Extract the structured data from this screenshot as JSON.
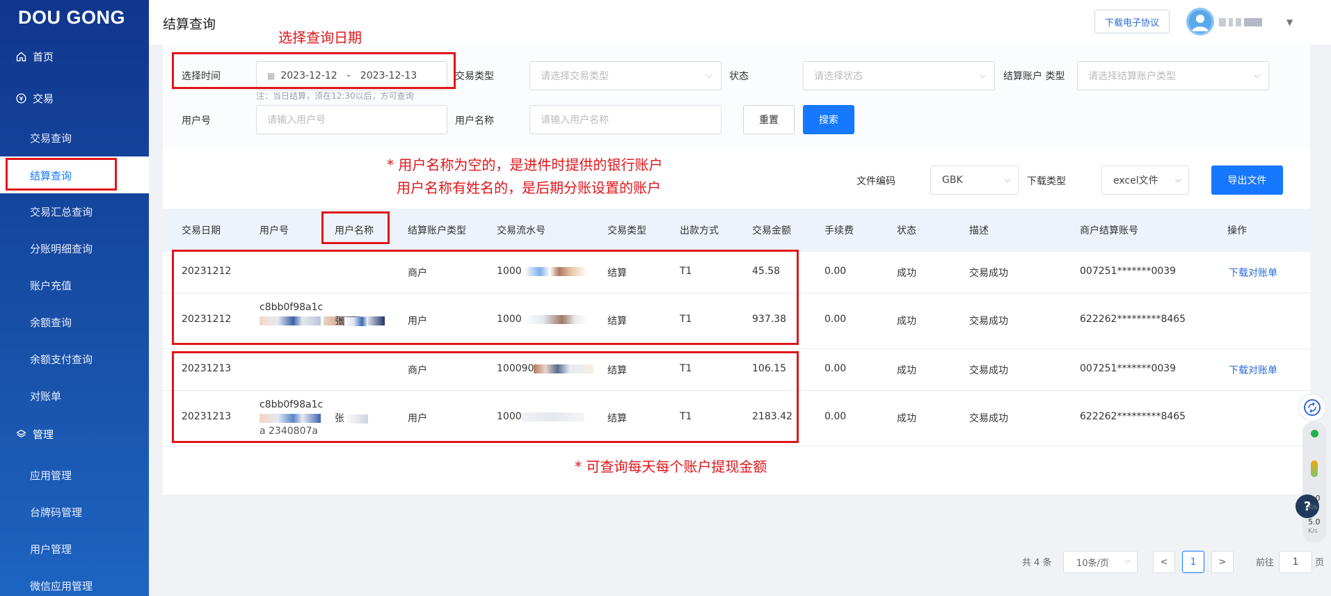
{
  "app": {
    "logo_text": "OU GONG",
    "logo_letter": "D"
  },
  "sidebar": {
    "home": "首页",
    "trade": "交易",
    "items": [
      "交易查询",
      "结算查询",
      "交易汇总查询",
      "分账明细查询",
      "账户充值",
      "余额查询",
      "余额支付查询",
      "对账单"
    ],
    "manage": "管理",
    "manage_items": [
      "应用管理",
      "台牌码管理",
      "用户管理",
      "微信应用管理"
    ]
  },
  "header": {
    "title": "结算查询",
    "agreement_btn": "下载电子协议"
  },
  "filters": {
    "time_label": "选择时间",
    "date_start": "2023-12-12",
    "date_sep": "-",
    "date_end": "2023-12-13",
    "date_hint": "注：当日结算，须在12:30以后，方可查询",
    "trade_type_label": "交易类型",
    "trade_type_placeholder": "请选择交易类型",
    "status_label": "状态",
    "status_placeholder": "请选择状态",
    "account_type_label": "结算账户 类型",
    "account_type_placeholder": "请选择结算账户类型",
    "user_no_label": "用户号",
    "user_no_placeholder": "请输入用户号",
    "user_name_label": "用户名称",
    "user_name_placeholder": "请输入用户名称",
    "reset": "重置",
    "search": "搜索"
  },
  "export": {
    "encoding_label": "文件编码",
    "encoding_value": "GBK",
    "download_type_label": "下载类型",
    "download_type_value": "excel文件",
    "export_btn": "导出文件"
  },
  "table": {
    "columns": [
      "交易日期",
      "用户号",
      "用户名称",
      "结算账户类型",
      "交易流水号",
      "交易类型",
      "出款方式",
      "交易金额",
      "手续费",
      "状态",
      "描述",
      "商户结算账号",
      "操作"
    ],
    "rows": [
      {
        "date": "20231212",
        "user_no": "",
        "user_name": "",
        "acct_type": "商户",
        "serial": "1000",
        "type": "结算",
        "method": "T1",
        "amount": "45.58",
        "fee": "0.00",
        "status": "成功",
        "desc": "交易成功",
        "account": "007251*******0039",
        "action": "下载对账单"
      },
      {
        "date": "20231212",
        "user_no": "c8bb0f98a1c",
        "user_name": "张",
        "acct_type": "用户",
        "serial": "1000",
        "type": "结算",
        "method": "T1",
        "amount": "937.38",
        "fee": "0.00",
        "status": "成功",
        "desc": "交易成功",
        "account": "622262*********8465",
        "action": ""
      },
      {
        "date": "20231213",
        "user_no": "",
        "user_name": "",
        "acct_type": "商户",
        "serial": "100090",
        "type": "结算",
        "method": "T1",
        "amount": "106.15",
        "fee": "0.00",
        "status": "成功",
        "desc": "交易成功",
        "account": "007251*******0039",
        "action": "下载对账单"
      },
      {
        "date": "20231213",
        "user_no": "c8bb0f98a1c",
        "user_no_line3": "a 2340807a",
        "user_name": "张",
        "acct_type": "用户",
        "serial": "1000",
        "type": "结算",
        "method": "T1",
        "amount": "2183.42",
        "fee": "0.00",
        "status": "成功",
        "desc": "交易成功",
        "account": "622262*********8465",
        "action": ""
      }
    ]
  },
  "annotations": {
    "pick_date": "选择查询日期",
    "note_line1": "* 用户名称为空的，是进件时提供的银行账户",
    "note_line2": "用户名称有姓名的，是后期分账设置的账户",
    "note_bottom": "* 可查询每天每个账户提现金额"
  },
  "pagination": {
    "total": "共 4 条",
    "page_size": "10条/页",
    "current": "1",
    "goto_label": "前往",
    "goto_value": "1",
    "page_suffix": "页"
  },
  "widget": {
    "speed_up": "0.0",
    "speed_down": "5.0",
    "unit": "K/s",
    "help": "?"
  },
  "colors": {
    "primary": "#1677ff",
    "sidebar_top": "#10368e",
    "annotation_red": "#e0151a"
  }
}
